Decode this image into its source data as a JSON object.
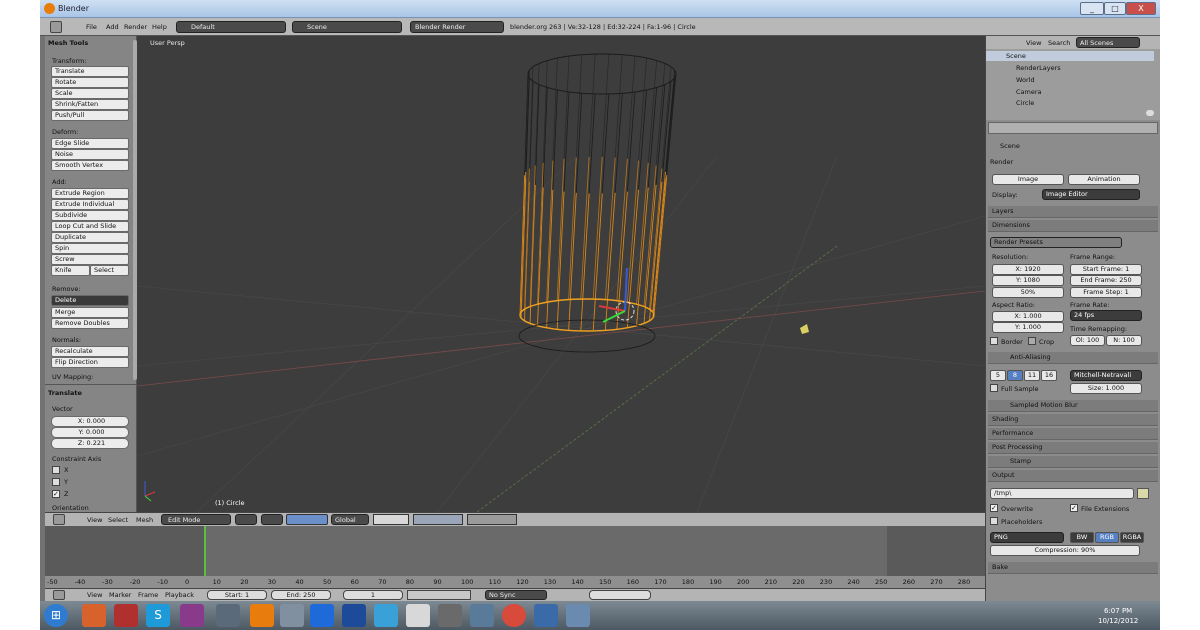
{
  "window": {
    "title": "Blender",
    "min": "_",
    "max": "□",
    "close": "X"
  },
  "info_header": {
    "menus": [
      "File",
      "Add",
      "Render",
      "Help"
    ],
    "layout": "Default",
    "scene": "Scene",
    "engine": "Blender Render",
    "stats": "blender.org 263 | Ve:32-128 | Ed:32-224 | Fa:1-96 | Circle"
  },
  "toolshelf": {
    "title": "Mesh Tools",
    "transform_label": "Transform:",
    "transform": [
      "Translate",
      "Rotate",
      "Scale",
      "Shrink/Fatten",
      "Push/Pull"
    ],
    "deform_label": "Deform:",
    "deform": [
      "Edge Slide",
      "Noise",
      "Smooth Vertex"
    ],
    "add_label": "Add:",
    "add": [
      "Extrude Region",
      "Extrude Individual",
      "Subdivide",
      "Loop Cut and Slide",
      "Duplicate",
      "Spin",
      "Screw"
    ],
    "knife": "Knife",
    "select": "Select",
    "remove_label": "Remove:",
    "delete": "Delete",
    "remove": [
      "Merge",
      "Remove Doubles"
    ],
    "normals_label": "Normals:",
    "normals": [
      "Recalculate",
      "Flip Direction"
    ],
    "uv_label": "UV Mapping:",
    "op_title": "Translate",
    "vector_label": "Vector",
    "vx": "X: 0.000",
    "vy": "Y: 0.000",
    "vz": "Z: 0.221",
    "constraint_label": "Constraint Axis",
    "axes": [
      "X",
      "Y",
      "Z"
    ],
    "orientation": "Orientation"
  },
  "viewport": {
    "persp": "User Persp",
    "object": "(1) Circle"
  },
  "view3d_header": {
    "menus": [
      "View",
      "Select",
      "Mesh"
    ],
    "mode": "Edit Mode",
    "orientation": "Global"
  },
  "timeline": {
    "ruler": [
      "-50",
      "-40",
      "-30",
      "-20",
      "-10",
      "0",
      "10",
      "20",
      "30",
      "40",
      "50",
      "60",
      "70",
      "80",
      "90",
      "100",
      "110",
      "120",
      "130",
      "140",
      "150",
      "160",
      "170",
      "180",
      "190",
      "200",
      "210",
      "220",
      "230",
      "240",
      "250",
      "260",
      "270",
      "280"
    ],
    "menus": [
      "View",
      "Marker",
      "Frame",
      "Playback"
    ],
    "start": "Start: 1",
    "end": "End: 250",
    "current": "1",
    "sync": "No Sync"
  },
  "outliner": {
    "view": "View",
    "search": "Search",
    "filter": "All Scenes",
    "items": [
      "Scene",
      "RenderLayers",
      "World",
      "Camera",
      "Circle"
    ]
  },
  "properties": {
    "context": "Scene",
    "render": "Render",
    "image": "Image",
    "animation": "Animation",
    "display_label": "Display:",
    "display": "Image Editor",
    "layers": "Layers",
    "dimensions": "Dimensions",
    "presets": "Render Presets",
    "resolution": "Resolution:",
    "res_x": "X: 1920",
    "res_y": "Y: 1080",
    "res_pct": "50%",
    "frame_range": "Frame Range:",
    "start": "Start Frame: 1",
    "end": "End Frame: 250",
    "step": "Frame Step: 1",
    "aspect": "Aspect Ratio:",
    "asp_x": "X: 1.000",
    "asp_y": "Y: 1.000",
    "frame_rate": "Frame Rate:",
    "fps": "24 fps",
    "border": "Border",
    "crop": "Crop",
    "time_remap": "Time Remapping:",
    "old": "Ol: 100",
    "new": "N: 100",
    "aa": "Anti-Aliasing",
    "aa_samples": [
      "5",
      "8",
      "11",
      "16"
    ],
    "filter": "Mitchell-Netravali",
    "full_sample": "Full Sample",
    "size": "Size: 1.000",
    "sampled_blur": "Sampled Motion Blur",
    "shading": "Shading",
    "performance": "Performance",
    "post": "Post Processing",
    "stamp": "Stamp",
    "output": "Output",
    "path": "/tmp\\",
    "overwrite": "Overwrite",
    "file_ext": "File Extensions",
    "placeholders": "Placeholders",
    "format": "PNG",
    "bw": "BW",
    "rgb": "RGB",
    "rgba": "RGBA",
    "compression": "Compression: 90%",
    "bake": "Bake"
  },
  "taskbar": {
    "time": "6:07 PM",
    "date": "10/12/2012"
  }
}
